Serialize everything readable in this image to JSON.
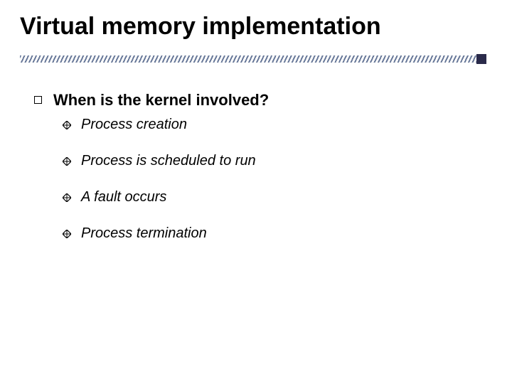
{
  "title": "Virtual memory implementation",
  "question": "When is the kernel involved?",
  "items": [
    "Process creation",
    "Process is scheduled to run",
    "A fault occurs",
    "Process termination"
  ]
}
